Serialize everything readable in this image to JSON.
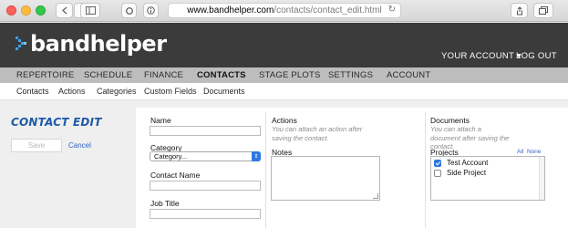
{
  "browser": {
    "url_domain": "www.bandhelper.com",
    "url_path": "/contacts/contact_edit.html"
  },
  "header": {
    "logo": "bandhelper",
    "account_label": "YOUR ACCOUNT ▾",
    "logout_label": "LOG OUT"
  },
  "nav": {
    "items": [
      "REPERTOIRE",
      "SCHEDULE",
      "FINANCE",
      "CONTACTS",
      "STAGE PLOTS",
      "SETTINGS",
      "ACCOUNT"
    ],
    "active": "CONTACTS"
  },
  "subnav": {
    "items": [
      "Contacts",
      "Actions",
      "Categories",
      "Custom Fields",
      "Documents"
    ]
  },
  "page": {
    "title": "CONTACT EDIT",
    "save_label": "Save",
    "cancel_label": "Cancel"
  },
  "form": {
    "name_label": "Name",
    "category_label": "Category",
    "category_value": "Category...",
    "contact_name_label": "Contact Name",
    "job_title_label": "Job Title"
  },
  "actions": {
    "label": "Actions",
    "hint": "You can attach an action after saving the contact.",
    "notes_label": "Notes"
  },
  "documents": {
    "label": "Documents",
    "hint": "You can attach a document after saving the contact.",
    "projects_label": "Projects",
    "all_label": "All",
    "none_label": "None",
    "projects": [
      {
        "name": "Test Account",
        "checked": true
      },
      {
        "name": "Side Project",
        "checked": false
      }
    ]
  },
  "colors": {
    "accent_blue": "#1f5aa8",
    "link_blue": "#2f63c4",
    "header_bg": "#3b3b3b",
    "nav_bg": "#bdbdbd"
  }
}
